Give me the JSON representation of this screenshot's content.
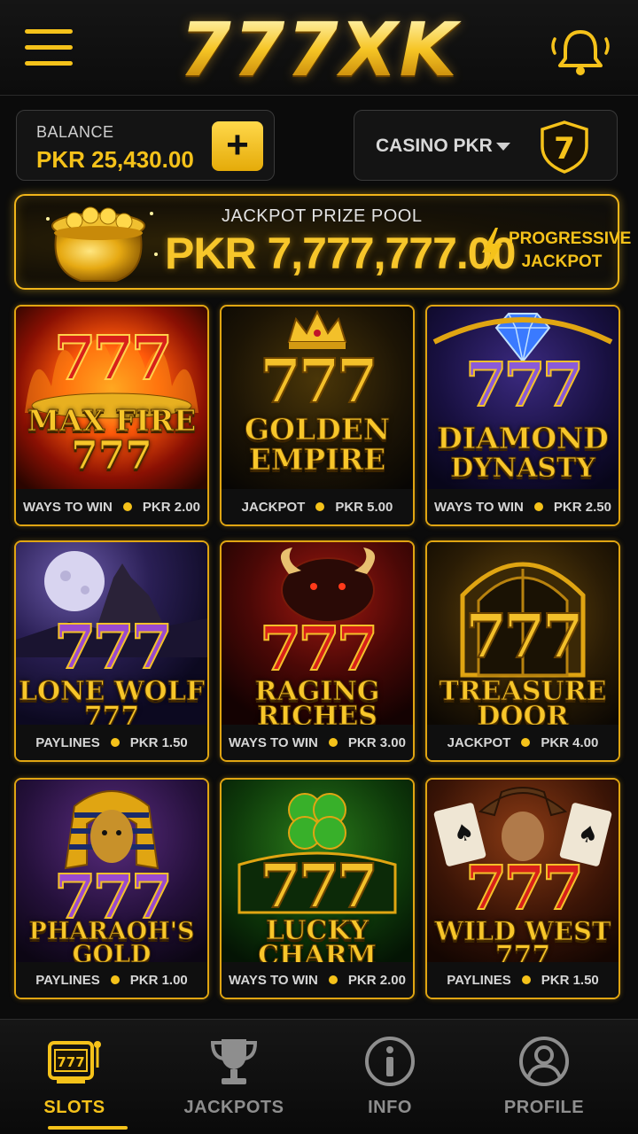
{
  "header": {
    "logo": "777XK",
    "menu_icon": "hamburger-menu-icon",
    "notification_icon": "bell-icon"
  },
  "balance": {
    "label": "BALANCE",
    "value": "PKR 25,430.00",
    "add_button": "+"
  },
  "casino_selector": {
    "label": "CASINO PKR",
    "badge": "7"
  },
  "jackpot": {
    "label": "JACKPOT PRIZE POOL",
    "value": "PKR 7,777,777.00",
    "tag_line1": "PROGRESSIVE",
    "tag_line2": "JACKPOT"
  },
  "games": [
    {
      "title1": "MAX FIRE",
      "title2": "777",
      "sevens": "777",
      "type": "WAYS TO WIN",
      "bet": "PKR 2.00"
    },
    {
      "title1": "GOLDEN",
      "title2": "EMPIRE",
      "sevens": "777",
      "type": "JACKPOT",
      "bet": "PKR 5.00"
    },
    {
      "title1": "DIAMOND",
      "title2": "DYNASTY",
      "sevens": "777",
      "type": "WAYS TO WIN",
      "bet": "PKR 2.50"
    },
    {
      "title1": "LONE WOLF",
      "title2": "777",
      "sevens": "777",
      "type": "PAYLINES",
      "bet": "PKR 1.50"
    },
    {
      "title1": "RAGING",
      "title2": "RICHES",
      "sevens": "777",
      "type": "WAYS TO WIN",
      "bet": "PKR 3.00"
    },
    {
      "title1": "TREASURE",
      "title2": "DOOR",
      "sevens": "777",
      "type": "JACKPOT",
      "bet": "PKR 4.00"
    },
    {
      "title1": "PHARAOH'S",
      "title2": "GOLD",
      "sevens": "777",
      "type": "PAYLINES",
      "bet": "PKR 1.00"
    },
    {
      "title1": "LUCKY",
      "title2": "CHARM",
      "sevens": "777",
      "type": "WAYS TO WIN",
      "bet": "PKR 2.00"
    },
    {
      "title1": "WILD WEST",
      "title2": "777",
      "sevens": "777",
      "type": "PAYLINES",
      "bet": "PKR 1.50"
    }
  ],
  "nav": [
    {
      "label": "SLOTS",
      "icon": "slot-machine-icon",
      "reel": "777"
    },
    {
      "label": "JACKPOTS",
      "icon": "trophy-icon"
    },
    {
      "label": "INFO",
      "icon": "info-icon"
    },
    {
      "label": "PROFILE",
      "icon": "profile-icon"
    }
  ],
  "colors": {
    "accent": "#f5c21a",
    "background": "#0b0b0b",
    "seven_red": "#d8201a",
    "seven_gold": "#f3c02a",
    "seven_purple": "#9a4ad0"
  }
}
